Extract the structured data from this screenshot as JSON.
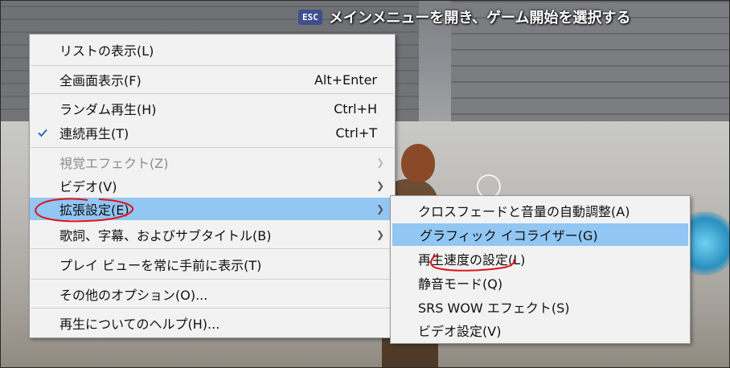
{
  "hint": {
    "key": "ESC",
    "text": "メインメニューを開き、ゲーム開始を選択する"
  },
  "main_menu": {
    "items": [
      {
        "label": "リストの表示(L)"
      },
      {
        "label": "全画面表示(F)",
        "shortcut": "Alt+Enter"
      },
      {
        "label": "ランダム再生(H)",
        "shortcut": "Ctrl+H"
      },
      {
        "label": "連続再生(T)",
        "shortcut": "Ctrl+T",
        "checked": true
      },
      {
        "label": "視覚エフェクト(Z)",
        "disabled": true,
        "submenu": true
      },
      {
        "label": "ビデオ(V)",
        "submenu": true
      },
      {
        "label": "拡張設定(E)",
        "submenu": true,
        "highlighted": true
      },
      {
        "label": "歌詞、字幕、およびサブタイトル(B)",
        "submenu": true
      },
      {
        "label": "プレイ ビューを常に手前に表示(T)"
      },
      {
        "label": "その他のオプション(O)..."
      },
      {
        "label": "再生についてのヘルプ(H)..."
      }
    ]
  },
  "sub_menu": {
    "items": [
      {
        "label": "クロスフェードと音量の自動調整(A)"
      },
      {
        "label": "グラフィック イコライザー(G)",
        "highlighted": true
      },
      {
        "label": "再生速度の設定(L)"
      },
      {
        "label": "静音モード(Q)"
      },
      {
        "label": "SRS WOW エフェクト(S)"
      },
      {
        "label": "ビデオ設定(V)"
      }
    ]
  },
  "icons": {
    "check": "checkmark-icon",
    "arrow": "chevron-right-icon"
  },
  "colors": {
    "highlight": "#92c6f3",
    "annotation": "#e0141e",
    "check": "#2d6fbf"
  }
}
